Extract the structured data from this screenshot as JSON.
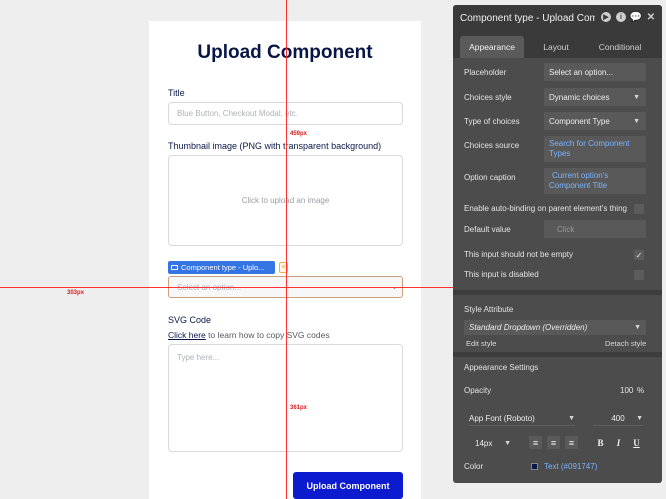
{
  "canvas": {
    "page_title": "Upload Component",
    "title_label": "Title",
    "title_placeholder": "Blue Button, Checkout Modal, etc.",
    "thumbnail_label": "Thumbnail image (PNG with transparent background)",
    "upload_text": "Click to upload an image",
    "element_tag": "Component type - Uplo...",
    "dropdown_placeholder": "Select an option...",
    "svg_label": "SVG Code",
    "help_link": "Click here",
    "help_rest": " to learn how to copy SVG codes",
    "textarea_placeholder": "Type here...",
    "submit_label": "Upload Component"
  },
  "guides": {
    "top_distance": "459px",
    "left_distance": "303px",
    "bottom_distance": "361px"
  },
  "panel": {
    "title": "Component type - Upload Compo",
    "tabs": [
      "Appearance",
      "Layout",
      "Conditional"
    ],
    "rows": {
      "placeholder_label": "Placeholder",
      "placeholder_value": "Select an option...",
      "choices_style_label": "Choices style",
      "choices_style_value": "Dynamic choices",
      "type_label": "Type of choices",
      "type_value": "Component Type",
      "source_label": "Choices source",
      "source_value_1": "Search for Component",
      "source_value_2": "Types",
      "caption_label": "Option caption",
      "caption_value_1": "Current option's",
      "caption_value_2": "Component Title",
      "autobind_label": "Enable auto-binding on parent element's thing",
      "default_label": "Default value",
      "default_value": "Click",
      "not_empty_label": "This input should not be empty",
      "disabled_label": "This input is disabled"
    },
    "style": {
      "heading": "Style Attribute",
      "value": "Standard Dropdown (Overridden)",
      "edit": "Edit style",
      "detach": "Detach style"
    },
    "appearance": {
      "heading": "Appearance Settings",
      "opacity_label": "Opacity",
      "opacity_value": "100",
      "opacity_unit": "%",
      "font_family": "App Font (Roboto)",
      "font_weight": "400",
      "font_size": "14px",
      "color_label": "Color",
      "color_value": "Text (#091747)",
      "color_hex": "#091747"
    }
  }
}
